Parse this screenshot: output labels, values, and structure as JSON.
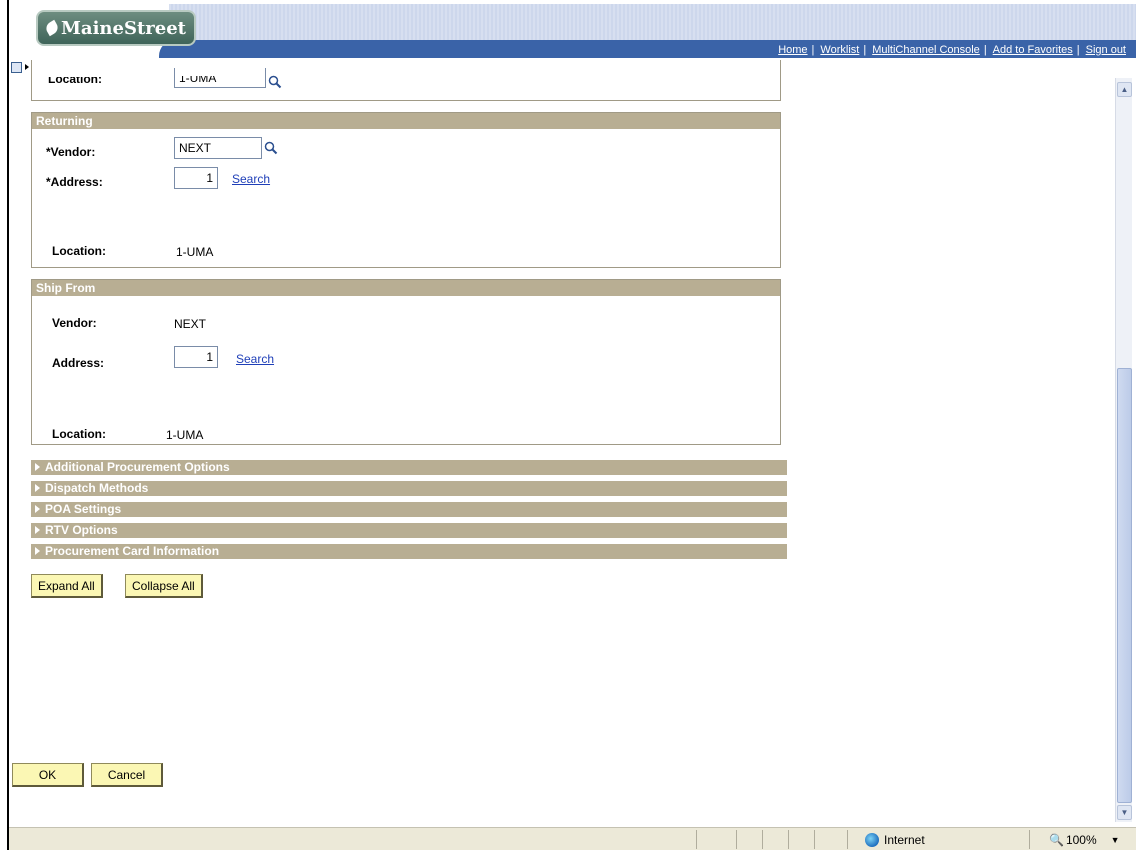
{
  "app": {
    "logo_text": "MaineStreet"
  },
  "nav": {
    "links": [
      "Home",
      "Worklist",
      "MultiChannel Console",
      "Add to Favorites",
      "Sign out"
    ]
  },
  "location_partial": {
    "label": "Location:",
    "value": "1-UMA"
  },
  "returning": {
    "title": "Returning",
    "vendor_label": "*Vendor:",
    "vendor_value": "NEXT",
    "address_label": "*Address:",
    "address_value": "1",
    "search_link": "Search",
    "location_label": "Location:",
    "location_value": "1-UMA"
  },
  "ship_from": {
    "title": "Ship From",
    "vendor_label": "Vendor:",
    "vendor_value": "NEXT",
    "address_label": "Address:",
    "address_value": "1",
    "search_link": "Search",
    "location_label": "Location:",
    "location_value": "1-UMA"
  },
  "sections": [
    "Additional Procurement Options",
    "Dispatch Methods",
    "POA Settings",
    "RTV Options",
    "Procurement Card Information"
  ],
  "buttons": {
    "expand_all": "Expand All",
    "collapse_all": "Collapse All",
    "ok": "OK",
    "cancel": "Cancel"
  },
  "statusbar": {
    "zone": "Internet",
    "zoom": "100%"
  },
  "colors": {
    "section_header": "#b8ae93",
    "nav_bar": "#3a63a8",
    "button": "#fbf7b4",
    "link": "#1f3fb8"
  }
}
